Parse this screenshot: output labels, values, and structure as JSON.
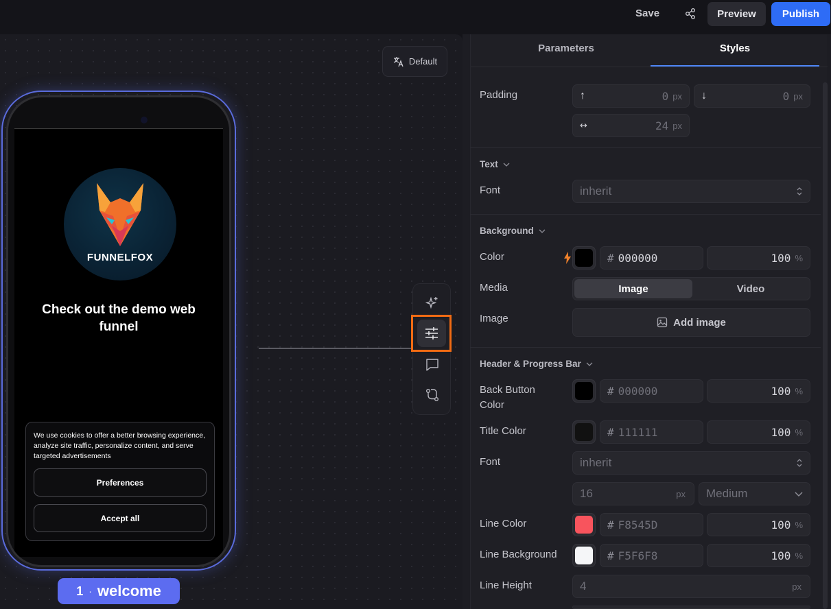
{
  "topbar": {
    "save": "Save",
    "preview": "Preview",
    "publish": "Publish"
  },
  "canvas": {
    "language_button": "Default"
  },
  "phone": {
    "logo_text": "FUNNELFOX",
    "title": "Check out the demo web funnel",
    "cookie_text": "We use cookies to offer a better browsing experience, analyze site traffic, personalize content, and serve targeted advertisements",
    "preferences": "Preferences",
    "accept_all": "Accept all"
  },
  "step": {
    "number": "1",
    "separator": "·",
    "name": "welcome"
  },
  "tools": [
    "ai-sparkle-icon",
    "sliders-icon",
    "comment-icon",
    "branch-icon"
  ],
  "panel": {
    "tabs": {
      "parameters": "Parameters",
      "styles": "Styles"
    },
    "padding": {
      "label": "Padding",
      "top_icon": "↑",
      "top": "0",
      "bottom_icon": "↓",
      "bottom": "0",
      "horizontal_icon": "↔",
      "horizontal": "24",
      "unit": "px"
    },
    "text": {
      "section": "Text",
      "font_label": "Font",
      "font_value": "inherit"
    },
    "background": {
      "section": "Background",
      "color_label": "Color",
      "color_hash": "#",
      "color_hex": "000000",
      "color_swatch": "#000000",
      "opacity": "100",
      "percent": "%",
      "media_label": "Media",
      "media_image": "Image",
      "media_video": "Video",
      "image_label": "Image",
      "add_image": "Add image"
    },
    "header": {
      "section": "Header & Progress Bar",
      "back_button_color_label": "Back Button Color",
      "back_hash": "#",
      "back_hex": "000000",
      "back_swatch": "#000000",
      "back_opacity": "100",
      "title_color_label": "Title Color",
      "title_hash": "#",
      "title_hex": "111111",
      "title_swatch": "#111111",
      "title_opacity": "100",
      "font_label": "Font",
      "font_value": "inherit",
      "font_size": "16",
      "font_size_unit": "px",
      "font_weight": "Medium",
      "line_color_label": "Line Color",
      "line_hash": "#",
      "line_hex": "F8545D",
      "line_swatch": "#F8545D",
      "line_opacity": "100",
      "line_background_label": "Line Background",
      "line_bg_hash": "#",
      "line_bg_hex": "F5F6F8",
      "line_bg_swatch": "#F5F6F8",
      "line_bg_opacity": "100",
      "line_height_label": "Line Height",
      "line_height": "4",
      "line_height_unit": "px",
      "percent": "%"
    }
  },
  "colors": {
    "accent": "#2E6CF6",
    "step_badge": "#5C6CF0",
    "highlight": "#F26B13"
  }
}
